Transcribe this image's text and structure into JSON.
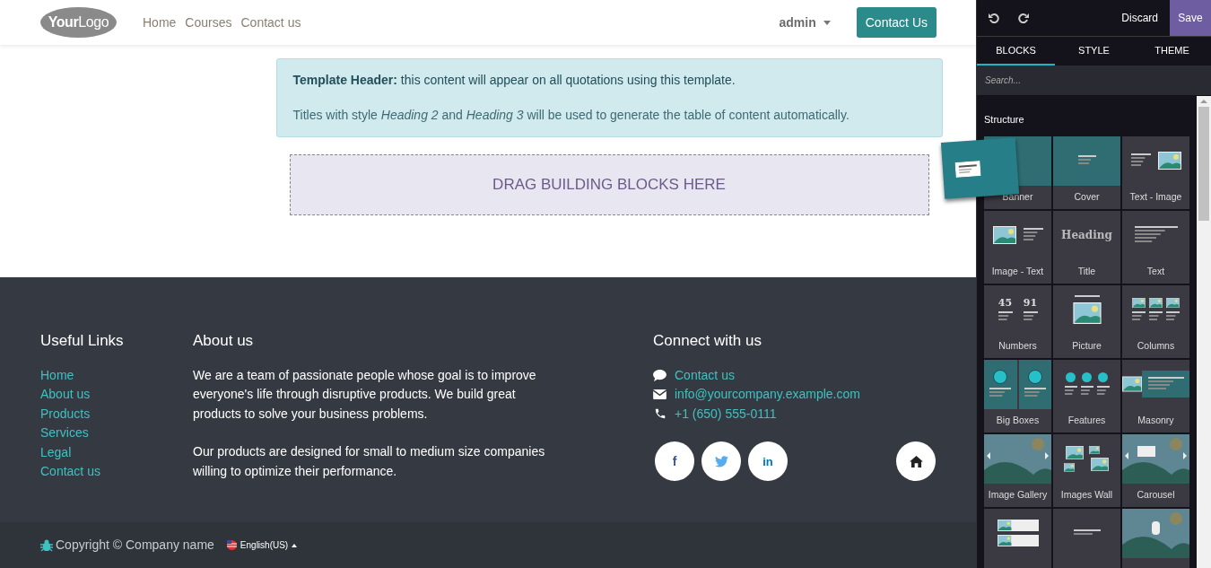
{
  "navbar": {
    "logo": {
      "word_1": "Your",
      "word_2": "Logo"
    },
    "links": [
      {
        "label": "Home",
        "selected": false
      },
      {
        "label": "Courses",
        "selected": false
      },
      {
        "label": "Contact us",
        "selected": false
      }
    ],
    "user": "admin",
    "cta": "Contact Us"
  },
  "alert": {
    "text": "**Template Header:** this content will appear on all quotations using this template.",
    "note": "Titles with style *Heading 2* and *Heading 3* will be used to generate the table of content automatically."
  },
  "dropzone": "DRAG BUILDING BLOCKS HERE",
  "footer": {
    "useful_links": {
      "title": "Useful Links",
      "links": [
        "Home",
        "About us",
        "Products",
        "Services",
        "Legal",
        "Contact us"
      ]
    },
    "about": {
      "title": "About us",
      "paragraphs": [
        "We are a team of passionate people whose goal is to improve everyone's life through disruptive products. We build great products to solve your business problems.",
        "Our products are designed for small to medium size companies willing to optimize their performance."
      ]
    },
    "connect": {
      "title": "Connect with us",
      "items": [
        {
          "kind": "chat",
          "text": "Contact us"
        },
        {
          "kind": "mail",
          "text": "info@yourcompany.example.com"
        },
        {
          "kind": "phone",
          "text": "+1 (650) 555-0111"
        }
      ],
      "social": [
        {
          "kind": "facebook",
          "glyph": "f",
          "color": "#3b5998"
        },
        {
          "kind": "twitter",
          "color": "#55acee"
        },
        {
          "kind": "linkedin",
          "glyph": "in",
          "color": "#0077b5"
        }
      ]
    },
    "copyright": "Copyright © Company name",
    "language": "English(US)"
  },
  "editor": {
    "discard": "Discard",
    "save": "Save",
    "tabs": [
      {
        "label": "BLOCKS",
        "selected": true
      },
      {
        "label": "STYLE",
        "selected": false
      },
      {
        "label": "THEME",
        "selected": false
      }
    ],
    "search_placeholder": "Search...",
    "section": "Structure",
    "blocks": [
      {
        "kind": "banner",
        "label": "Banner"
      },
      {
        "kind": "cover",
        "label": "Cover"
      },
      {
        "kind": "text_image",
        "label": "Text - Image"
      },
      {
        "kind": "image_text",
        "label": "Image - Text"
      },
      {
        "kind": "title",
        "label": "Title",
        "sample": "Heading"
      },
      {
        "kind": "text",
        "label": "Text"
      },
      {
        "kind": "numbers",
        "label": "Numbers",
        "sample": "45",
        "sample_2": "91"
      },
      {
        "kind": "picture",
        "label": "Picture"
      },
      {
        "kind": "columns",
        "label": "Columns"
      },
      {
        "kind": "big_boxes",
        "label": "Big Boxes"
      },
      {
        "kind": "features",
        "label": "Features"
      },
      {
        "kind": "masonry",
        "label": "Masonry"
      },
      {
        "kind": "gallery",
        "label": "Image Gallery"
      },
      {
        "kind": "wall",
        "label": "Images Wall"
      },
      {
        "kind": "carousel",
        "label": "Carousel"
      },
      {
        "kind": "media_list"
      },
      {
        "kind": "showcase"
      },
      {
        "kind": "parallax"
      }
    ]
  }
}
